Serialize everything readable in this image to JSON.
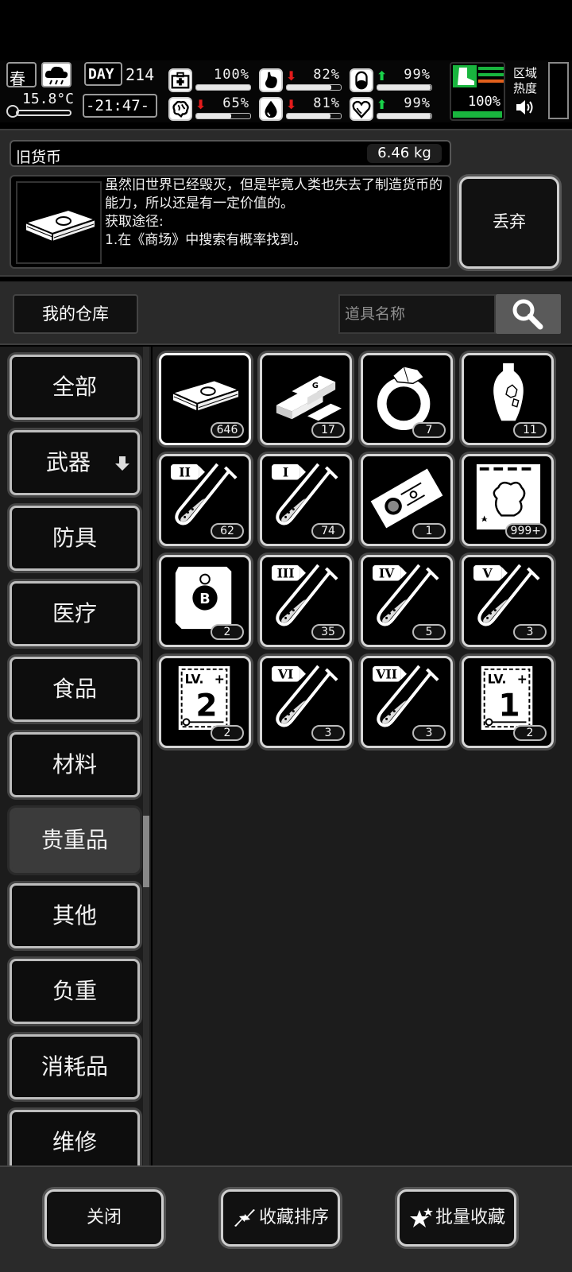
{
  "status": {
    "season": "春",
    "temperature": "15.8°C",
    "day_label": "DAY",
    "day": "214",
    "clock": "-21:47-",
    "stats": [
      {
        "icon": "medkit-icon",
        "trend": "",
        "value": "100%",
        "level": 1.0
      },
      {
        "icon": "stomach-icon",
        "trend": "down",
        "value": "82%",
        "level": 0.82
      },
      {
        "icon": "pill-icon",
        "trend": "up",
        "value": "99%",
        "level": 0.99
      },
      {
        "icon": "brain-icon",
        "trend": "down",
        "value": "65%",
        "level": 0.65
      },
      {
        "icon": "water-drop-icon",
        "trend": "down",
        "value": "81%",
        "level": 0.81
      },
      {
        "icon": "heart-icon",
        "trend": "up",
        "value": "99%",
        "level": 0.99
      }
    ],
    "stamina": "100%",
    "region_heat": "区域\n热度"
  },
  "item": {
    "name": "旧货币",
    "weight": "6.46 kg",
    "description": "虽然旧世界已经毁灭，但是毕竟人类也失去了制造货币的能力，所以还是有一定价值的。\n获取途径:\n1.在《商场》中搜索有概率找到。",
    "discard_label": "丢弃"
  },
  "warehouse": {
    "title": "我的仓库",
    "search_placeholder": "道具名称"
  },
  "categories": [
    {
      "label": "全部",
      "active": false
    },
    {
      "label": "武器",
      "active": false,
      "has_arrow": true
    },
    {
      "label": "防具",
      "active": false
    },
    {
      "label": "医疗",
      "active": false
    },
    {
      "label": "食品",
      "active": false
    },
    {
      "label": "材料",
      "active": false
    },
    {
      "label": "贵重品",
      "active": true
    },
    {
      "label": "其他",
      "active": false
    },
    {
      "label": "负重",
      "active": false
    },
    {
      "label": "消耗品",
      "active": false
    },
    {
      "label": "维修",
      "active": false
    }
  ],
  "items": [
    {
      "icon": "cash-stack-icon",
      "count": "646",
      "selected": true
    },
    {
      "icon": "gold-bars-icon",
      "count": "17"
    },
    {
      "icon": "diamond-ring-icon",
      "count": "7"
    },
    {
      "icon": "vase-icon",
      "count": "11"
    },
    {
      "icon": "test-tube-icon",
      "numeral": "II",
      "count": "62"
    },
    {
      "icon": "test-tube-icon",
      "numeral": "I",
      "count": "74"
    },
    {
      "icon": "ticket-icon",
      "count": "1"
    },
    {
      "icon": "trading-card-icon",
      "count": "999+"
    },
    {
      "icon": "bitcoin-note-icon",
      "count": "2"
    },
    {
      "icon": "test-tube-icon",
      "numeral": "III",
      "count": "35"
    },
    {
      "icon": "test-tube-icon",
      "numeral": "IV",
      "count": "5"
    },
    {
      "icon": "test-tube-icon",
      "numeral": "V",
      "count": "3"
    },
    {
      "icon": "level-card-icon",
      "level_text": "LV.",
      "level_num": "2",
      "count": "2"
    },
    {
      "icon": "test-tube-icon",
      "numeral": "VI",
      "count": "3"
    },
    {
      "icon": "test-tube-icon",
      "numeral": "VII",
      "count": "3"
    },
    {
      "icon": "level-card-icon",
      "level_text": "LV.",
      "level_num": "1",
      "count": "2"
    }
  ],
  "bottom": {
    "close_label": "关闭",
    "sort_label": "收藏排序",
    "batch_label": "批量收藏"
  }
}
